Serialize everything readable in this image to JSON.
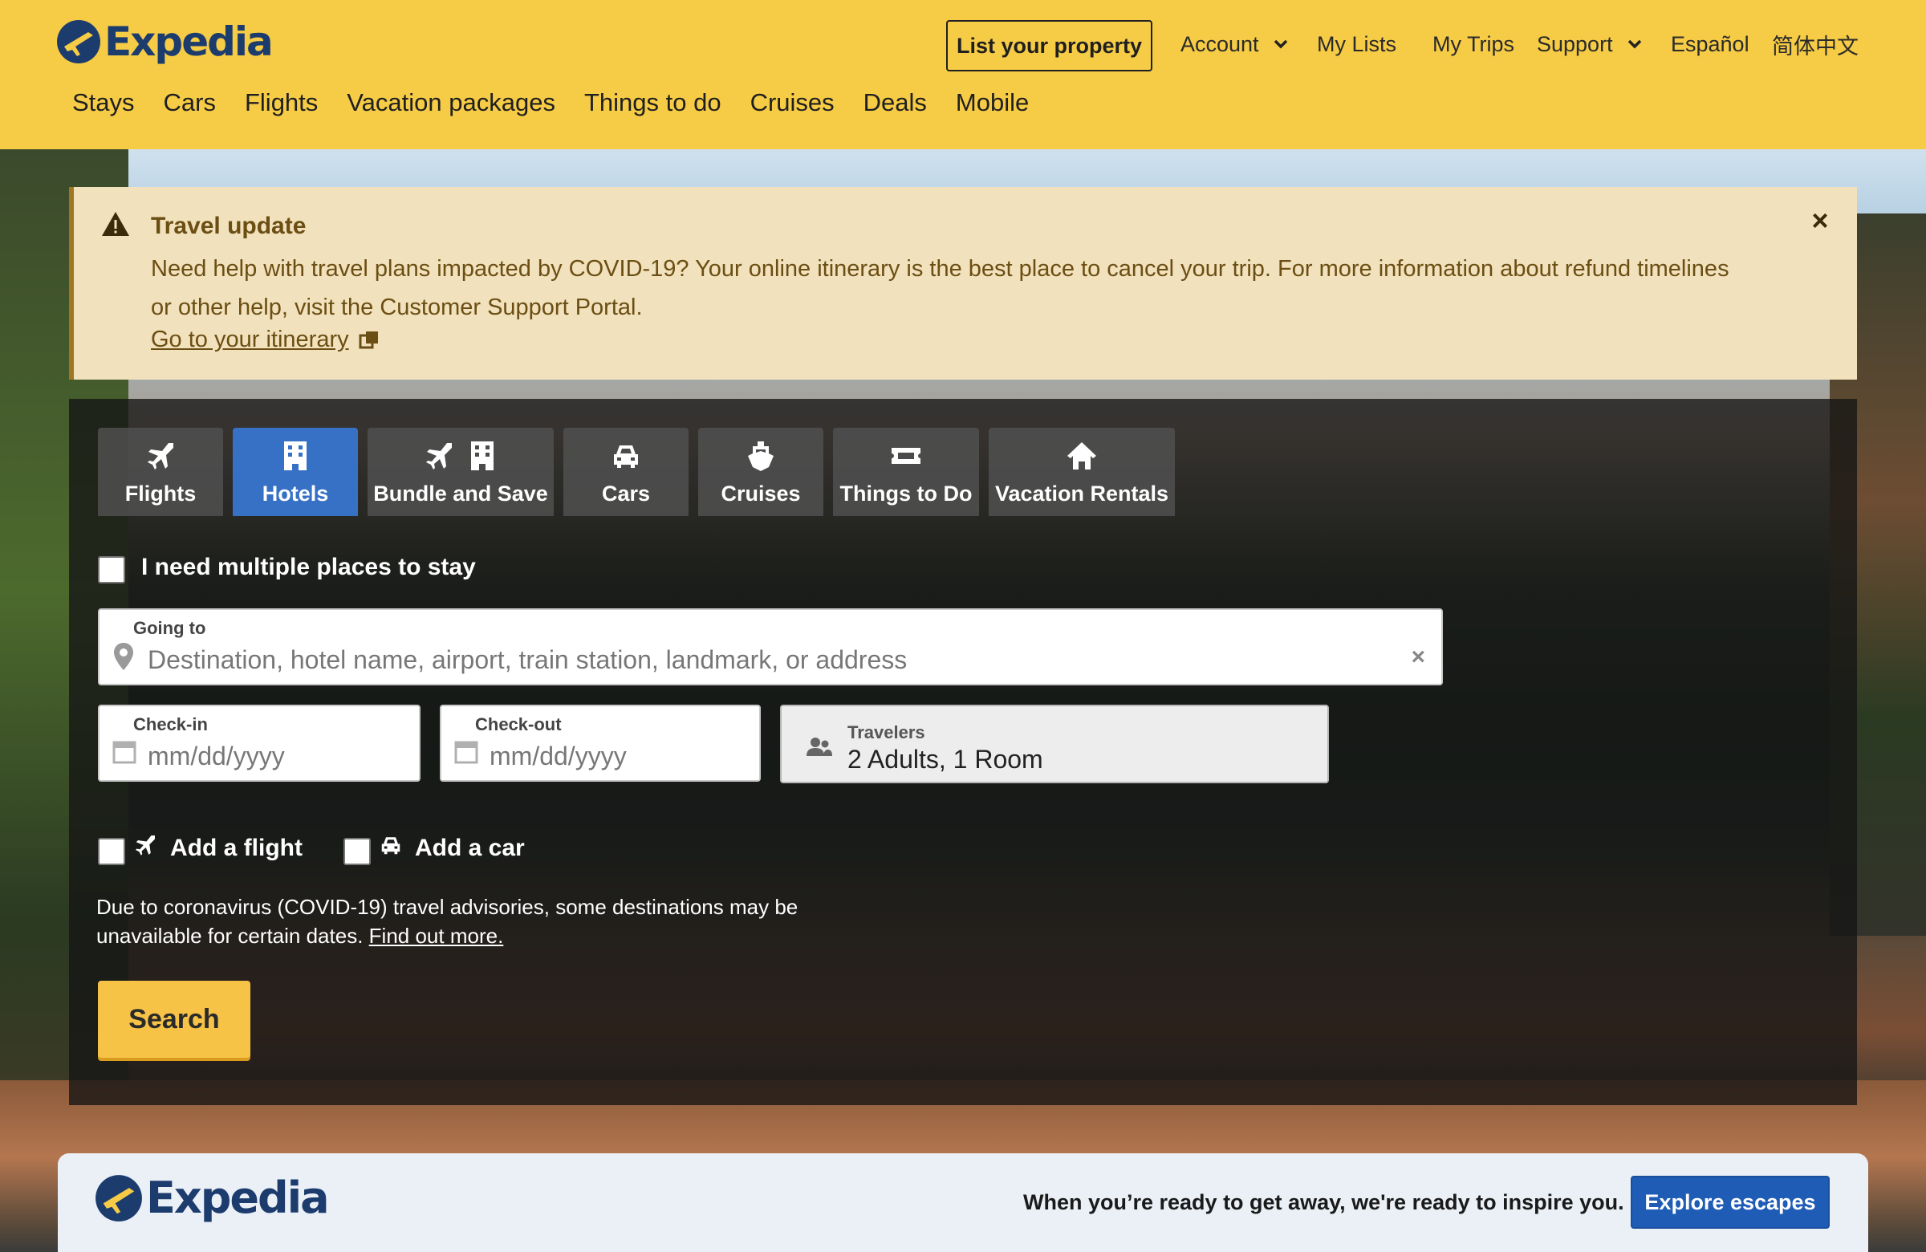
{
  "header": {
    "brand": "Expedia",
    "list_property": "List your property",
    "utility_links": [
      "Account",
      "My Lists",
      "My Trips",
      "Support",
      "Español",
      "简体中文"
    ],
    "main_nav": [
      "Stays",
      "Cars",
      "Flights",
      "Vacation packages",
      "Things to do",
      "Cruises",
      "Deals",
      "Mobile"
    ]
  },
  "alert": {
    "title": "Travel update",
    "body": "Need help with travel plans impacted by COVID-19? Your online itinerary is the best place to cancel your trip. For more information about refund timelines or other help, visit the Customer Support Portal.",
    "link": "Go to your itinerary",
    "close_icon": "×"
  },
  "search": {
    "tabs": [
      "Flights",
      "Hotels",
      "Bundle and Save",
      "Cars",
      "Cruises",
      "Things to Do",
      "Vacation Rentals"
    ],
    "active_tab": "Hotels",
    "multiple_places": "I need multiple places to stay",
    "going_to": {
      "label": "Going to",
      "placeholder": "Destination, hotel name, airport, train station, landmark, or address"
    },
    "checkin": {
      "label": "Check-in",
      "placeholder": "mm/dd/yyyy"
    },
    "checkout": {
      "label": "Check-out",
      "placeholder": "mm/dd/yyyy"
    },
    "travelers": {
      "label": "Travelers",
      "value": "2 Adults, 1 Room"
    },
    "add_flight": "Add a flight",
    "add_car": "Add a car",
    "notice": "Due to coronavirus (COVID-19) travel advisories, some destinations may be unavailable for certain dates.",
    "notice_link": "Find out more.",
    "search_button": "Search"
  },
  "banner": {
    "brand": "Expedia",
    "tagline": "When you’re ready to get away, we're ready to inspire you.",
    "cta": "Explore escapes"
  },
  "colors": {
    "header_bg": "#f6cb45",
    "brand_navy": "#1d3c6e",
    "tab_active": "#3671c6",
    "alert_bg": "#f1e1bc",
    "search_button": "#f6c346",
    "cta_blue": "#1e5cb5"
  }
}
